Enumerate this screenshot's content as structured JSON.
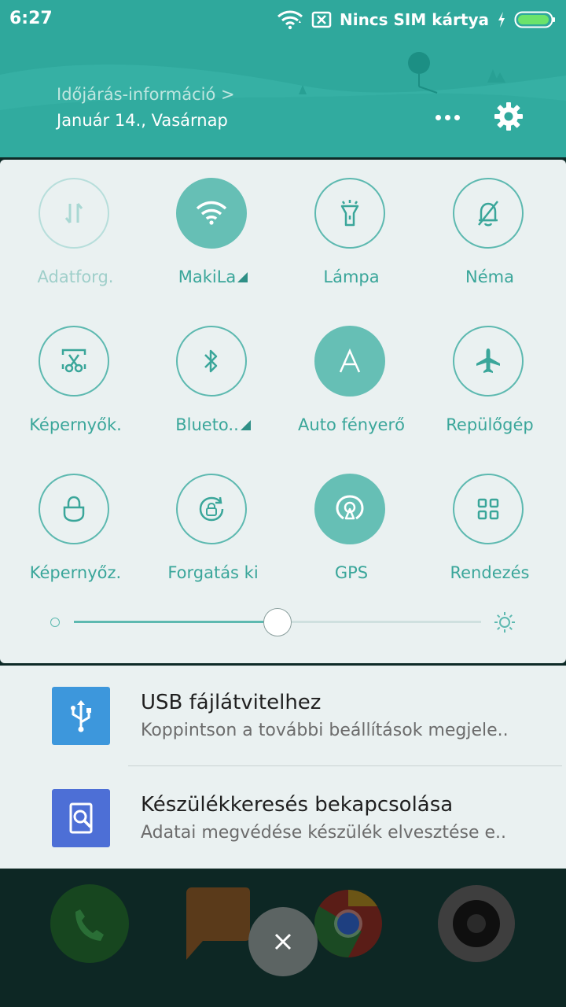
{
  "status": {
    "time": "6:27",
    "sim_text": "Nincs SIM kártya",
    "icons": [
      "wifi-icon",
      "no-sim-icon",
      "charging-icon",
      "battery-icon"
    ]
  },
  "header": {
    "weather_link": "Időjárás-információ >",
    "date": "Január 14., Vasárnap",
    "buttons": [
      "more-icon",
      "settings-icon"
    ]
  },
  "colors": {
    "accent": "#2fa89c",
    "tile_active": "#66bfb5",
    "panel_bg": "#eaf1f1"
  },
  "tiles": [
    {
      "label": "Adatforg.",
      "icon": "data-transfer-icon",
      "state": "disabled"
    },
    {
      "label": "MakiLa",
      "icon": "wifi-icon",
      "state": "on"
    },
    {
      "label": "Lámpa",
      "icon": "flashlight-icon",
      "state": "off"
    },
    {
      "label": "Néma",
      "icon": "silent-bell-icon",
      "state": "off"
    },
    {
      "label": "Képernyők.",
      "icon": "screenshot-scissors-icon",
      "state": "off"
    },
    {
      "label": "Blueto..",
      "icon": "bluetooth-icon",
      "state": "off"
    },
    {
      "label": "Auto fényerő",
      "icon": "auto-brightness-icon",
      "state": "on"
    },
    {
      "label": "Repülőgép",
      "icon": "airplane-icon",
      "state": "off"
    },
    {
      "label": "Képernyőz.",
      "icon": "lock-icon",
      "state": "off"
    },
    {
      "label": "Forgatás ki",
      "icon": "rotation-lock-icon",
      "state": "off"
    },
    {
      "label": "GPS",
      "icon": "gps-icon",
      "state": "on"
    },
    {
      "label": "Rendezés",
      "icon": "grid-icon",
      "state": "off"
    }
  ],
  "brightness": {
    "level_fraction": 0.5
  },
  "notifications": [
    {
      "title": "USB fájlátvitelhez",
      "body": "Koppintson a további beállítások megjele..",
      "icon": "usb-icon",
      "color": "#3d97dc"
    },
    {
      "title": "Készülékkeresés bekapcsolása",
      "body": "Adatai megvédése készülék elvesztése e..",
      "icon": "find-device-icon",
      "color": "#4d6fd6"
    }
  ],
  "dock": [
    "phone-icon",
    "messages-icon",
    "chrome-icon",
    "camera-icon"
  ],
  "close_button": "close-icon"
}
